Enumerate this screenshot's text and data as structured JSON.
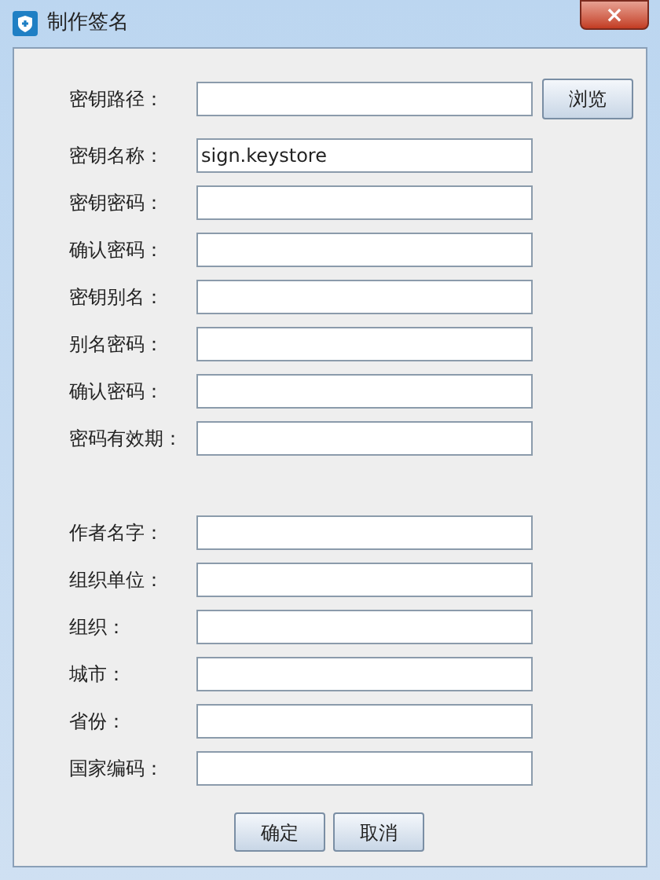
{
  "window": {
    "title": "制作签名",
    "close": "×"
  },
  "groups": [
    [
      {
        "label": "密钥路径：",
        "button": "浏览"
      },
      {
        "label": "密钥名称：",
        "value": "sign.keystore"
      },
      {
        "label": "密钥密码："
      },
      {
        "label": "确认密码："
      },
      {
        "label": "密钥别名："
      },
      {
        "label": "别名密码："
      },
      {
        "label": "确认密码："
      },
      {
        "label": "密码有效期："
      }
    ],
    [
      {
        "label": "作者名字："
      },
      {
        "label": "组织单位："
      },
      {
        "label": "组织："
      },
      {
        "label": "城市："
      },
      {
        "label": "省份："
      },
      {
        "label": "国家编码："
      }
    ]
  ],
  "buttons": [
    "确定",
    "取消"
  ]
}
